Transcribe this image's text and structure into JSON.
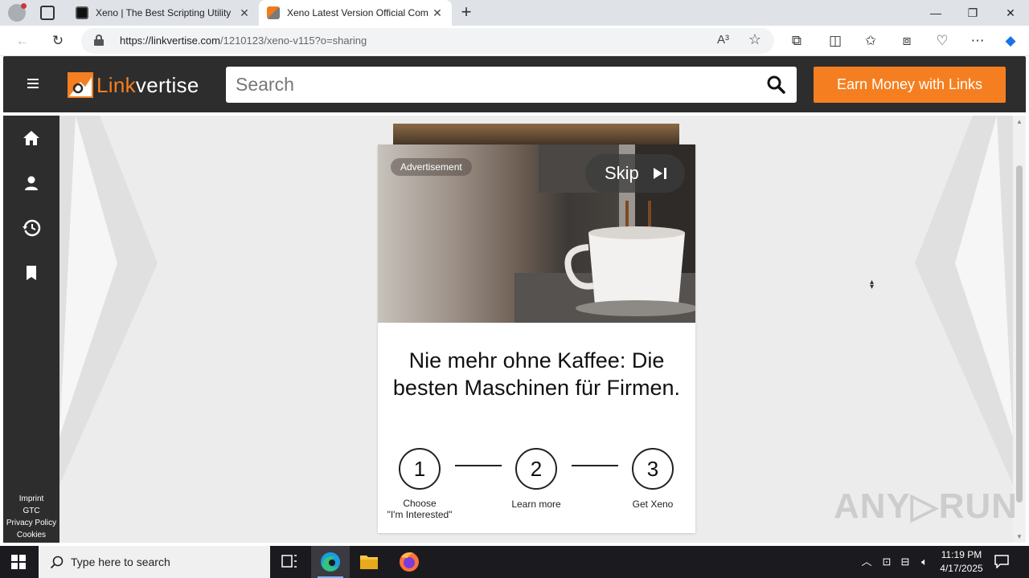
{
  "browser": {
    "tabs": [
      {
        "title": "Xeno | The Best Scripting Utility",
        "close": "✕"
      },
      {
        "title": "Xeno Latest Version Official Com",
        "close": "✕"
      }
    ],
    "new_tab": "+",
    "window_controls": {
      "minimize": "—",
      "restore": "❐",
      "close": "✕"
    },
    "url_host": "https://linkvertise.com",
    "url_path": "/1210123/xeno-v115?o=sharing",
    "read_aloud": "A³"
  },
  "header": {
    "logo_primary": "Link",
    "logo_secondary": "vertise",
    "search_placeholder": "Search",
    "earn_button": "Earn Money with Links"
  },
  "sidebar": {
    "items": [
      "home-icon",
      "user-icon",
      "history-icon",
      "bookmark-icon"
    ],
    "footer_links": [
      "Imprint",
      "GTC",
      "Privacy Policy",
      "Cookies"
    ]
  },
  "ad": {
    "advertisement_label": "Advertisement",
    "skip_label": "Skip",
    "headline": "Nie mehr ohne Kaffee: Die besten Maschinen für Firmen.",
    "steps": [
      {
        "number": "1",
        "label_line1": "Choose",
        "label_line2": "\"I'm Interested\""
      },
      {
        "number": "2",
        "label_line1": "Learn more",
        "label_line2": ""
      },
      {
        "number": "3",
        "label_line1": "Get Xeno",
        "label_line2": ""
      }
    ]
  },
  "watermark": "ANY▷RUN",
  "taskbar": {
    "search_placeholder": "Type here to search",
    "time": "11:19 PM",
    "date": "4/17/2025"
  },
  "colors": {
    "brand_orange": "#f57f20",
    "header_dark": "#2d2d2d",
    "taskbar": "#1b1b1f"
  }
}
